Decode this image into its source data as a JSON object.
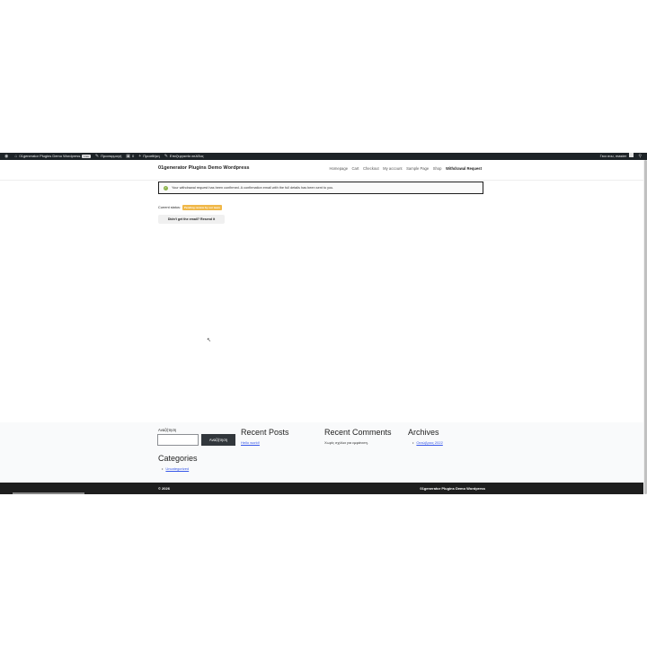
{
  "adminbar": {
    "site_name": "01generator Plugins Demo Wordpress",
    "live_badge": "Live",
    "customize": "Προσαρμογή",
    "comments_count": "0",
    "new": "Προσθήκη",
    "edit_page": "Επεξεργασία σελίδας",
    "greeting": "Γεια σου, master"
  },
  "header": {
    "site_title": "01generator Plugins Demo Wordpress",
    "nav": [
      "Homepage",
      "Cart",
      "Checkout",
      "My account",
      "Sample Page",
      "Shop",
      "Withdrawal Request"
    ]
  },
  "main": {
    "notice": "Your withdrawal request has been confirmed. A confirmation email with the full details has been sent to you.",
    "status_label": "Current status:",
    "status_value": "Pending review by our team",
    "resend_label": "Didn't get the email? Resend it"
  },
  "footer": {
    "search_label": "Αναζήτηση",
    "search_placeholder": "",
    "search_button": "Αναζήτηση",
    "recent_posts_title": "Recent Posts",
    "recent_posts": [
      "Hello world!"
    ],
    "recent_comments_title": "Recent Comments",
    "recent_comments_empty": "Χωρίς σχόλια για εμφάνιση.",
    "archives_title": "Archives",
    "archives": [
      "Οκτώβριος 2022"
    ],
    "categories_title": "Categories",
    "categories": [
      "Uncategorized"
    ],
    "copyright": "© 2026",
    "footer_site_title": "01generator Plugins Demo Wordpress"
  },
  "colors": {
    "adminbar": "#1d2327",
    "accent_link": "#3858e9",
    "status_badge": "#f0b849",
    "success_check": "#8bb34a"
  }
}
